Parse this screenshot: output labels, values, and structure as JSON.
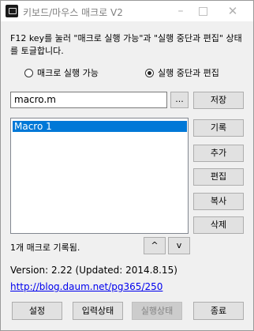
{
  "window": {
    "title": "키보드/마우스 매크로 V2",
    "minimize_symbol": "–",
    "close_symbol": "✕"
  },
  "description": "F12 key를 눌러 \"매크로 실행 가능\"과 \"실행 중단과 편집\" 상태를 토글합니다.",
  "mode": {
    "options": [
      {
        "label": "매크로 실행 가능",
        "selected": false
      },
      {
        "label": "실행 중단과 편집",
        "selected": true
      }
    ]
  },
  "file": {
    "value": "macro.m",
    "browse_label": "...",
    "save_label": "저장"
  },
  "macros": {
    "items": [
      "Macro 1"
    ],
    "selected_index": 0,
    "status": "1개 매크로 기록됨."
  },
  "actions": {
    "record": "기록",
    "add": "추가",
    "edit": "편집",
    "copy": "복사",
    "delete": "삭제",
    "move_up": "^",
    "move_down": "v"
  },
  "info": {
    "version": "Version: 2.22 (Updated: 2014.8.15)",
    "link": "http://blog.daum.net/pg365/250"
  },
  "footer": {
    "settings": "설정",
    "input_state": "입력상태",
    "run_state": "실행상태",
    "exit": "종료"
  },
  "colors": {
    "selection": "#0078d7",
    "link": "#0000ee",
    "window_bg": "#f0f0f0"
  }
}
